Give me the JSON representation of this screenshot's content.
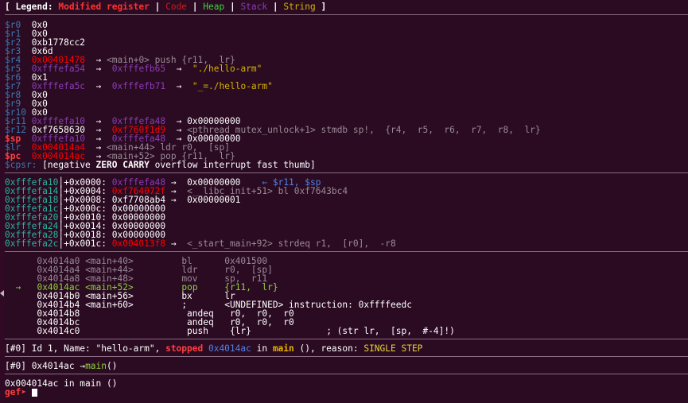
{
  "legend": {
    "prefix": "[ Legend: ",
    "modified": "Modified register",
    "code": "Code",
    "heap": "Heap",
    "stack": "Stack",
    "string": "String",
    "bar": " | ",
    "close": " ]"
  },
  "registers": [
    {
      "name": "$r0  ",
      "val": "0x0"
    },
    {
      "name": "$r1  ",
      "val": "0x0"
    },
    {
      "name": "$r2  ",
      "val": "0xb1778cc2"
    },
    {
      "name": "$r3  ",
      "val": "0x6d"
    },
    {
      "name": "$r4  ",
      "val": "0x00401478",
      "arrow1": "→",
      "deref": "<main+0> push {r11,  lr}"
    },
    {
      "name": "$r5  ",
      "val": "0xfffefa54",
      "arrow1": "→",
      "ptr": "0xfffefb65",
      "arrow2": "→",
      "deref": "\"./hello-arm\""
    },
    {
      "name": "$r6  ",
      "val": "0x1"
    },
    {
      "name": "$r7  ",
      "val": "0xfffefa5c",
      "arrow1": "→",
      "ptr": "0xfffefb71",
      "arrow2": "→",
      "deref": "\"_=./hello-arm\""
    },
    {
      "name": "$r8  ",
      "val": "0x0"
    },
    {
      "name": "$r9  ",
      "val": "0x0"
    },
    {
      "name": "$r10 ",
      "val": "0x0"
    },
    {
      "name": "$r11 ",
      "val": "0xfffefa10",
      "arrow1": "→",
      "ptr": "0xfffefa48",
      "arrow2": "→",
      "deref": "0x00000000"
    },
    {
      "name": "$r12 ",
      "val": "0xf7658630",
      "arrow1": "→",
      "ptr": "0xf760f1d9",
      "arrow2": "→",
      "deref": "<pthread_mutex_unlock+1> stmdb sp!,  {r4,  r5,  r6,  r7,  r8,  lr}"
    },
    {
      "name": "$sp  ",
      "val": "0xfffefa10",
      "arrow1": "→",
      "ptr": "0xfffefa48",
      "arrow2": "→",
      "deref": "0x00000000"
    },
    {
      "name": "$lr  ",
      "val": "0x004014a4",
      "arrow1": "→",
      "deref": "<main+44> ldr r0,  [sp]"
    },
    {
      "name": "$pc  ",
      "val": "0x004014ac",
      "arrow1": "→",
      "deref": "<main+52> pop {r11,  lr}"
    }
  ],
  "cpsr": {
    "name": "$cpsr: ",
    "open": "[",
    "negative": "negative ",
    "zero": "ZERO",
    "carry": "CARRY",
    "rest": " overflow interrupt fast thumb]"
  },
  "stack": [
    {
      "addr": "0xfffefa10",
      "off": "+0x0000: ",
      "val": "0xfffefa48",
      "arrow": " →",
      "deref": "0x00000000",
      "note": "← $r11, $sp"
    },
    {
      "addr": "0xfffefa14",
      "off": "+0x0004: ",
      "val": "0xf764072f",
      "arrow": " →",
      "deref": "<__libc_init+51> bl 0xf7643bc4"
    },
    {
      "addr": "0xfffefa18",
      "off": "+0x0008: ",
      "val": "0xf7708ab4",
      "arrow": " →",
      "deref": "0x00000001"
    },
    {
      "addr": "0xfffefa1c",
      "off": "+0x000c: ",
      "val": "0x00000000"
    },
    {
      "addr": "0xfffefa20",
      "off": "+0x0010: ",
      "val": "0x00000000"
    },
    {
      "addr": "0xfffefa24",
      "off": "+0x0014: ",
      "val": "0x00000000"
    },
    {
      "addr": "0xfffefa28",
      "off": "+0x0018: ",
      "val": "0x00000000"
    },
    {
      "addr": "0xfffefa2c",
      "off": "+0x001c: ",
      "val": "0x004013f8",
      "arrow": " →",
      "deref": "<_start_main+92> strdeq r1,  [r0],  -r8"
    }
  ],
  "code": [
    {
      "addr": "0x4014a0",
      "sym": "<main+40>",
      "op": "bl",
      "args": "0x401500"
    },
    {
      "addr": "0x4014a4",
      "sym": "<main+44>",
      "op": "ldr",
      "args": "r0,  [sp]"
    },
    {
      "addr": "0x4014a8",
      "sym": "<main+48>",
      "op": "mov",
      "args": "sp,  r11"
    },
    {
      "addr": "0x4014ac",
      "sym": "<main+52>",
      "op": "pop",
      "args": "{r11,  lr}",
      "current": true,
      "marker": "→"
    },
    {
      "addr": "0x4014b0",
      "sym": "<main+56>",
      "op": "bx",
      "args": "lr"
    },
    {
      "addr": "0x4014b4",
      "sym": "<main+60>",
      "op": ";",
      "args": "<UNDEFINED> instruction: 0xffffeedc"
    },
    {
      "addr": "0x4014b8",
      "sym": "",
      "op": "andeq",
      "args": "r0,  r0,  r0"
    },
    {
      "addr": "0x4014bc",
      "sym": "",
      "op": "andeq",
      "args": "r0,  r0,  r0"
    },
    {
      "addr": "0x4014c0",
      "sym": "",
      "op": "push",
      "args": "{lr}",
      "comment": "; (str lr,  [sp,  #-4]!)"
    }
  ],
  "thread": {
    "id": "[#0]",
    "desc": " Id 1, Name: \"hello-arm\", ",
    "status": "stopped",
    "addr": " 0x4014ac",
    "in": " in ",
    "func": "main",
    "reason_label": " (), reason: ",
    "reason": "SINGLE STEP"
  },
  "trace": {
    "id": "[#0]",
    "addr": " 0x4014ac ",
    "arrow": "→",
    "func": "main",
    "parens": "()"
  },
  "location": "0x004014ac in main ()",
  "prompt": "gef➤ "
}
